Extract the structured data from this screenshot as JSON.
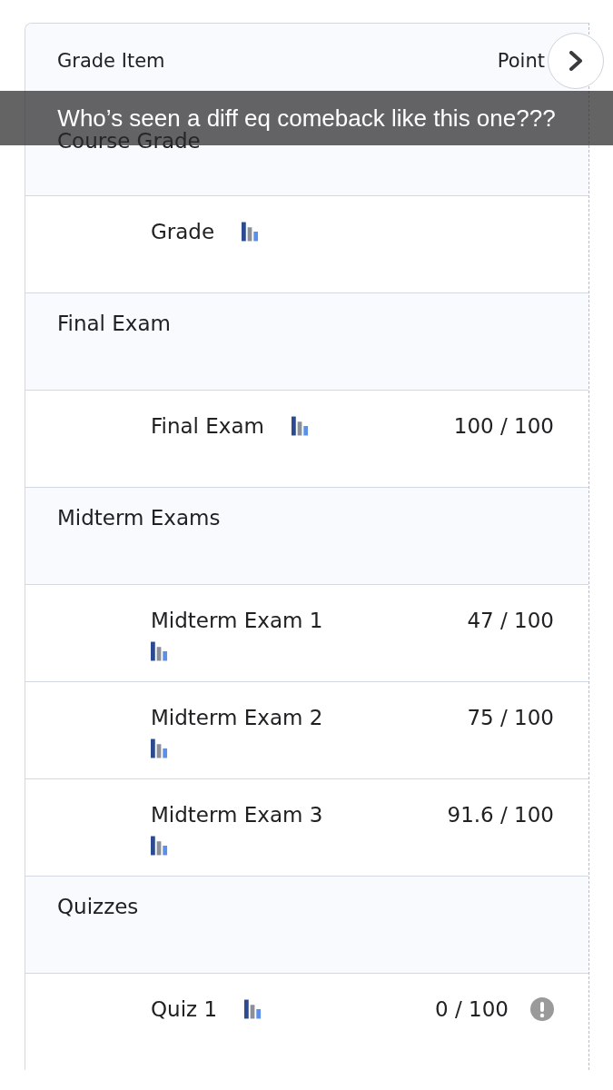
{
  "table": {
    "columns": [
      "Grade Item",
      "Point"
    ],
    "rows": [
      {
        "kind": "section",
        "name": "Course Grade"
      },
      {
        "kind": "item",
        "name": "Grade",
        "stats": true
      },
      {
        "kind": "section",
        "name": "Final Exam"
      },
      {
        "kind": "item",
        "name": "Final Exam",
        "stats": true,
        "score": "100 / 100"
      },
      {
        "kind": "section",
        "name": "Midterm Exams"
      },
      {
        "kind": "item",
        "name": "Midterm Exam 1",
        "stats": true,
        "score": "47 / 100"
      },
      {
        "kind": "item",
        "name": "Midterm Exam 2",
        "stats": true,
        "score": "75 / 100"
      },
      {
        "kind": "item",
        "name": "Midterm Exam 3",
        "stats": true,
        "score": "91.6 / 100"
      },
      {
        "kind": "section",
        "name": "Quizzes"
      },
      {
        "kind": "item",
        "name": "Quiz 1",
        "stats": true,
        "score": "0 / 100",
        "alert": true
      }
    ]
  },
  "caption": "Who’s seen a diff eq comeback like this one???"
}
